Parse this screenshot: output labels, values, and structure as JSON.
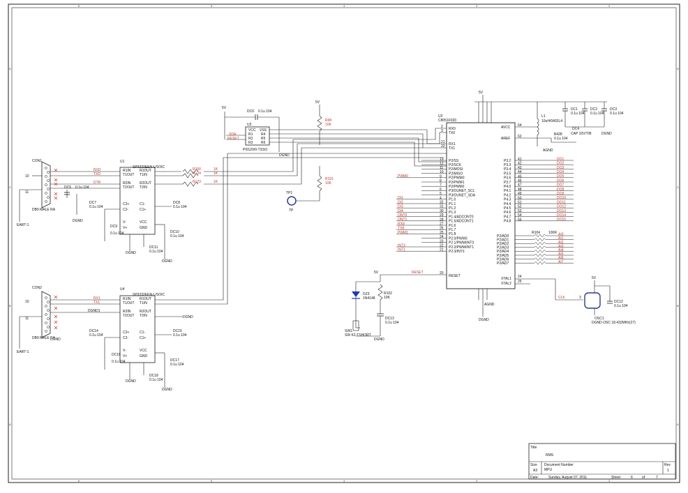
{
  "sheet_border": {
    "top_numbers": [
      "6",
      "5",
      "4",
      "3",
      "2",
      "1"
    ],
    "side_letters": [
      "D",
      "C",
      "B",
      "A"
    ]
  },
  "serial_ports": [
    {
      "connector_ref": "CON1",
      "connector_desc": "DB9 MALE RA",
      "pins": [
        "10",
        "11"
      ],
      "ground_label": "EART-1",
      "transceiver_ref": "U1",
      "transceiver_part": "SP3232EEN-L/SOIC",
      "left_pins": [
        "R1IN",
        "T1OUT",
        "R2IN",
        "T2OUT",
        "C2+",
        "C2-",
        "V-",
        "V+"
      ],
      "right_pins": [
        "R1OUT",
        "T1IN",
        "R2OUT",
        "T2IN",
        "C1-",
        "C1+",
        "VCC",
        "GND"
      ],
      "nets": [
        "RXD",
        "TXD",
        "DTR"
      ],
      "caps": [
        {
          "ref": "DC5",
          "val": "0.1u 104"
        },
        {
          "ref": "DC7",
          "val": "0.1u 104"
        },
        {
          "ref": "DC8",
          "val": "0.1u 104"
        },
        {
          "ref": "DC9",
          "val": "0.1u 104"
        },
        {
          "ref": "DC10",
          "val": "0.1u 104"
        },
        {
          "ref": "DC11",
          "val": "0.1u 104"
        }
      ],
      "gnd": "DGND"
    },
    {
      "connector_ref": "CON2",
      "connector_desc": "DB9 MALE RA",
      "pins": [
        "10",
        "11"
      ],
      "ground_label": "EART-1",
      "transceiver_ref": "U4",
      "transceiver_part": "SP3232EEN-L/SOIC",
      "left_pins": [
        "R1IN",
        "T1OUT",
        "R2IN",
        "T2OUT",
        "C2+",
        "C2-",
        "V-",
        "V+"
      ],
      "right_pins": [
        "R1OUT",
        "T1IN",
        "R2OUT",
        "T2IN",
        "C1-",
        "C1+",
        "VCC",
        "GND"
      ],
      "nets": [
        "RX1",
        "TX1",
        "DGND1"
      ],
      "caps": [
        {
          "ref": "DC14",
          "val": "0.1u 104"
        },
        {
          "ref": "DC15",
          "val": "0.1u 104"
        },
        {
          "ref": "DC16",
          "val": "0.1u 104"
        },
        {
          "ref": "DC17",
          "val": "0.1u 104"
        },
        {
          "ref": "DC18",
          "val": "0.1u 104"
        }
      ],
      "gnd": "DGND"
    }
  ],
  "series_resistors": [
    {
      "ref": "R100",
      "val": "1K"
    },
    {
      "ref": "R124",
      "val": "1K"
    },
    {
      "ref": "R123",
      "val": "1K"
    }
  ],
  "isolator": {
    "ref": "U3",
    "part": "PI0120/0-TSSO",
    "cap_ref": "DC6",
    "cap_val": "0.1u 104",
    "supply": "5V",
    "pins_left": [
      "VCC",
      "R1",
      "R2",
      "R3"
    ],
    "pins_right": [
      "VSS",
      "R4",
      "R5",
      "R6"
    ],
    "labels": [
      "SDA",
      "RESET"
    ]
  },
  "pullups": [
    {
      "ref": "R98",
      "val": "10K",
      "supply": "5V"
    },
    {
      "ref": "R101",
      "val": "10K"
    }
  ],
  "testpoint": {
    "ref": "TP1",
    "label": "TP"
  },
  "mcu": {
    "ref": "U2",
    "part": "C8051F020",
    "left_top_pins": [
      {
        "num": "2",
        "name": "RX0"
      },
      {
        "num": "3",
        "name": "TX0"
      },
      {
        "num": "21",
        "name": "RX1"
      },
      {
        "num": "22",
        "name": "TX1"
      }
    ],
    "left_pins": [
      {
        "num": "13",
        "name": "P2/SS"
      },
      {
        "num": "12",
        "name": "P2/SCK"
      },
      {
        "num": "11",
        "name": "P2/MOSI"
      },
      {
        "num": "10",
        "name": "P2/MISO"
      },
      {
        "num": "9",
        "name": "P2/PWM0"
      },
      {
        "num": "8",
        "name": "P2/PWM1"
      },
      {
        "num": "7",
        "name": "P2/PWM2"
      },
      {
        "num": "6",
        "name": "P3/OUNET_SCL"
      },
      {
        "num": "5",
        "name": "P3/OUNET_SDA"
      },
      {
        "num": "4",
        "name": "P1.0"
      },
      {
        "num": "32",
        "name": "P1.1"
      },
      {
        "num": "31",
        "name": "P1.2"
      },
      {
        "num": "30",
        "name": "P1.3"
      },
      {
        "num": "29",
        "name": "P1.4/ADCONT0"
      },
      {
        "num": "28",
        "name": "P1.5/ADCONT1"
      },
      {
        "num": "27",
        "name": "P1.6"
      },
      {
        "num": "26",
        "name": "P1.7"
      },
      {
        "num": "25",
        "name": "P1.8"
      },
      {
        "num": "24",
        "name": "P2.0/PWM3"
      },
      {
        "num": "23",
        "name": "P2.1/PWM/INT0"
      },
      {
        "num": "22",
        "name": "P2.2/PWM/INT1"
      },
      {
        "num": "21",
        "name": "P2.3/INT3"
      }
    ],
    "left_nets": [
      "PWM0",
      "DI1",
      "DI2",
      "DI3",
      "DI4",
      "ONT0",
      "ONT1",
      "RX8",
      "TX8",
      "PWM1",
      "INT3",
      "INT1"
    ],
    "right_top": [
      "AVCC",
      "AREF"
    ],
    "right_top_nums": [
      "64",
      "62"
    ],
    "right_pins": [
      "P3.2",
      "P3.3",
      "P3.4",
      "P3.5",
      "P3.6",
      "P3.7",
      "P4.0",
      "P4.1",
      "P4.2",
      "P4.3",
      "P4.4",
      "P4.5",
      "P4.6",
      "P4.7",
      "P4.8"
    ],
    "right_nets": [
      "DO1",
      "DO2",
      "DO3",
      "DO4",
      "DO5",
      "DO6",
      "DO7",
      "DO8",
      "DO9",
      "DO10",
      "DO11",
      "DO12",
      "DO13",
      "DO14",
      "DO15"
    ],
    "ad_pins": [
      "P2/AD0",
      "P2/AD1",
      "P2/AD2",
      "P2/AD3",
      "P2/AD4",
      "P2/AD5",
      "P2/AD6",
      "P2/AD7"
    ],
    "ad_resistor": {
      "ref": "R104",
      "val": "100R"
    },
    "ad_nets": [
      "AI0",
      "AI1",
      "AI2",
      "AI3",
      "AI4",
      "AI5",
      "AI6",
      "AI7"
    ],
    "reset_pin": "RESET",
    "reset_num": "20",
    "xtal_pins": [
      "XTAL1",
      "XTAL2"
    ],
    "xtal_nums": [
      "24",
      "25"
    ]
  },
  "power_filter": {
    "supply": "5V",
    "inductor_ref": "L1",
    "inductor_val": "10uH/0402L4",
    "caps": [
      {
        "ref": "DC1",
        "val": "0.1u 104"
      },
      {
        "ref": "DC2",
        "val": "0.1u 104"
      },
      {
        "ref": "DC3",
        "val": "0.1u 104"
      },
      {
        "ref": "DC4",
        "val": "CAP 10V/T/B"
      }
    ],
    "bead": {
      "ref": "B428",
      "val": "0.1u 104"
    },
    "grounds": [
      "AGND",
      "DGND"
    ]
  },
  "reset_circuit": {
    "diode_ref": "DZ3",
    "diode_val": "1N4148",
    "resistor_ref": "R102",
    "resistor_val": "10K",
    "cap_ref": "DC13",
    "cap_val": "0.1u 104",
    "switch_ref": "SW1",
    "switch_val": "SW K2-TSHORT",
    "net": "RESET",
    "supply": "5V",
    "gnd": "DGND"
  },
  "clock": {
    "net": "CLK",
    "osc_pin": "3",
    "osc_label": "DGND OSC 18.432MHz(27)",
    "cap_ref": "DC12",
    "cap_val": "0.1u 104",
    "osc_ref": "OSC1",
    "supply": "5V",
    "gnd": "AGND"
  },
  "title_block": {
    "title_label": "Title",
    "title_value": "RMS",
    "size_label": "Size",
    "size_value": "A3",
    "docnum_label": "Document Number",
    "docnum_value": "MPU",
    "rev_label": "Rev",
    "rev_value": "1",
    "date_label": "Date:",
    "date_value": "Sunday, August 07, 2011",
    "sheet_label": "Sheet",
    "sheet_value": "6",
    "of_label": "of",
    "of_value": "7"
  },
  "colors": {
    "wire": "#1a1a1a",
    "label_red": "#c0392b",
    "trace_blue": "#2a3b8f",
    "border": "#222222"
  }
}
